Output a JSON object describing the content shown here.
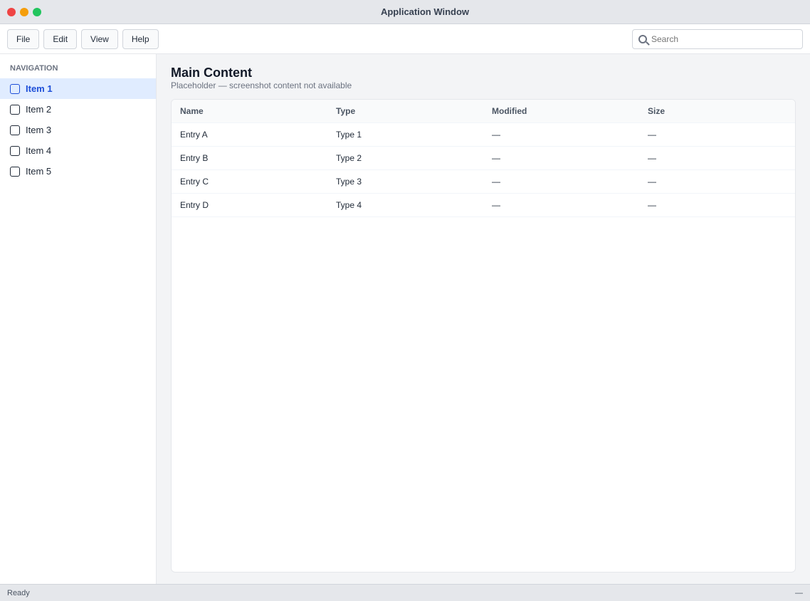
{
  "window": {
    "title": "Application Window"
  },
  "toolbar": {
    "buttons": [
      "File",
      "Edit",
      "View",
      "Help"
    ],
    "search_placeholder": "Search"
  },
  "sidebar": {
    "heading": "Navigation",
    "items": [
      {
        "label": "Item 1",
        "icon": "folder-icon"
      },
      {
        "label": "Item 2",
        "icon": "folder-icon"
      },
      {
        "label": "Item 3",
        "icon": "folder-icon"
      },
      {
        "label": "Item 4",
        "icon": "folder-icon"
      },
      {
        "label": "Item 5",
        "icon": "folder-icon"
      }
    ]
  },
  "main": {
    "title": "Main Content",
    "subtitle": "Placeholder — screenshot content not available",
    "table": {
      "columns": [
        "Name",
        "Type",
        "Modified",
        "Size"
      ],
      "rows": [
        [
          "Entry A",
          "Type 1",
          "—",
          "—"
        ],
        [
          "Entry B",
          "Type 2",
          "—",
          "—"
        ],
        [
          "Entry C",
          "Type 3",
          "—",
          "—"
        ],
        [
          "Entry D",
          "Type 4",
          "—",
          "—"
        ]
      ]
    }
  },
  "status": {
    "left": "Ready",
    "right": "—"
  },
  "colors": {
    "accent": "#1d4ed8"
  }
}
